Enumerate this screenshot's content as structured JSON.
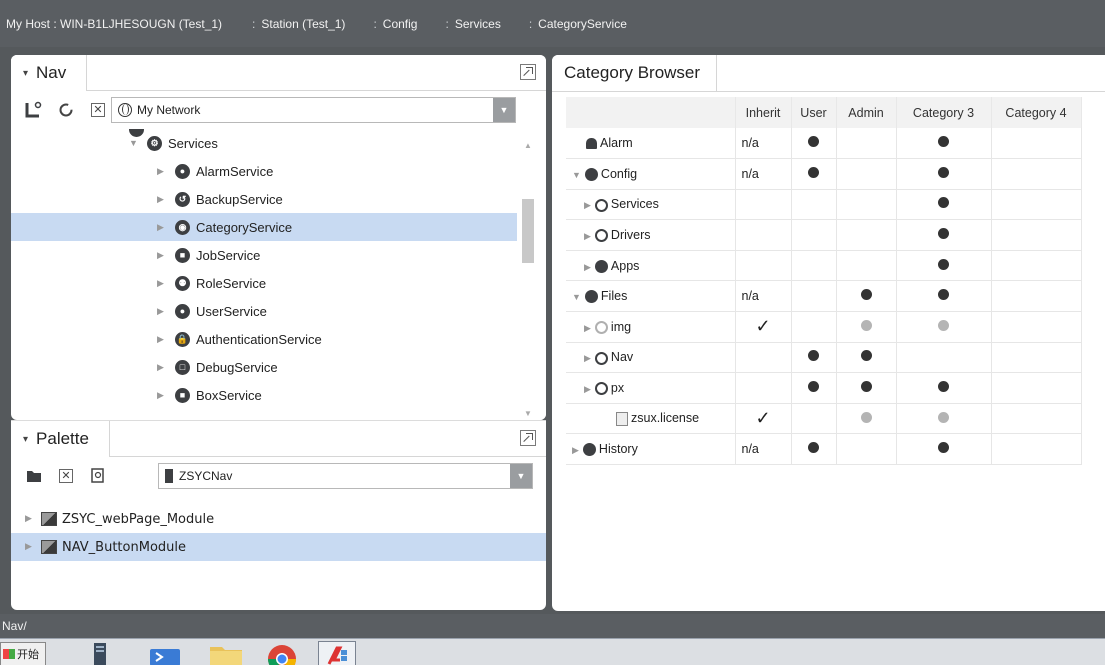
{
  "breadcrumbs": [
    {
      "label": "My Host : WIN-B1LJHESOUGN (Test_1)",
      "sep": ""
    },
    {
      "label": "Station (Test_1)",
      "sep": ":"
    },
    {
      "label": "Config",
      "sep": ":"
    },
    {
      "label": "Services",
      "sep": ":"
    },
    {
      "label": "CategoryService",
      "sep": ":"
    }
  ],
  "nav": {
    "tab_label": "Nav",
    "dropdown_value": "My Network",
    "tree": [
      {
        "label": "Services",
        "icon": "services-icon",
        "glyph": "⚙",
        "expanded": true,
        "indent": 1
      },
      {
        "label": "AlarmService",
        "icon": "alarm-icon",
        "glyph": "●",
        "indent": 2
      },
      {
        "label": "BackupService",
        "icon": "backup-icon",
        "glyph": "↺",
        "indent": 2
      },
      {
        "label": "CategoryService",
        "icon": "category-icon",
        "glyph": "◉",
        "indent": 2,
        "selected": true
      },
      {
        "label": "JobService",
        "icon": "job-icon",
        "glyph": "■",
        "indent": 2
      },
      {
        "label": "RoleService",
        "icon": "role-icon",
        "glyph": "⚉",
        "indent": 2
      },
      {
        "label": "UserService",
        "icon": "user-icon",
        "glyph": "●",
        "indent": 2
      },
      {
        "label": "AuthenticationService",
        "icon": "lock-icon",
        "glyph": "🔒",
        "indent": 2
      },
      {
        "label": "DebugService",
        "icon": "debug-icon",
        "glyph": "□",
        "indent": 2
      },
      {
        "label": "BoxService",
        "icon": "box-icon",
        "glyph": "■",
        "indent": 2
      }
    ]
  },
  "palette": {
    "tab_label": "Palette",
    "dropdown_value": "ZSYCNav",
    "items": [
      {
        "label": "ZSYC_webPage_Module",
        "selected": false
      },
      {
        "label": "NAV_ButtonModule",
        "selected": true
      }
    ]
  },
  "category_browser": {
    "tab_label": "Category Browser",
    "columns": [
      "",
      "Inherit",
      "User",
      "Admin",
      "Category 3",
      "Category 4"
    ],
    "rows": [
      {
        "name": "Alarm",
        "icon": "bell",
        "depth": 0,
        "tri": "",
        "inherit": "n/a",
        "cells": [
          "dark",
          "",
          "dark",
          ""
        ]
      },
      {
        "name": "Config",
        "icon": "solid",
        "depth": 0,
        "tri": "▼",
        "inherit": "n/a",
        "cells": [
          "dark",
          "",
          "dark",
          ""
        ]
      },
      {
        "name": "Services",
        "icon": "outline",
        "depth": 1,
        "tri": "▶",
        "inherit": "",
        "cells": [
          "",
          "",
          "dark",
          ""
        ]
      },
      {
        "name": "Drivers",
        "icon": "outline",
        "depth": 1,
        "tri": "▶",
        "inherit": "",
        "cells": [
          "",
          "",
          "dark",
          ""
        ]
      },
      {
        "name": "Apps",
        "icon": "solid",
        "depth": 1,
        "tri": "▶",
        "inherit": "",
        "cells": [
          "",
          "",
          "dark",
          ""
        ]
      },
      {
        "name": "Files",
        "icon": "solid",
        "depth": 0,
        "tri": "▼",
        "inherit": "n/a",
        "cells": [
          "",
          "dark",
          "dark",
          ""
        ]
      },
      {
        "name": "img",
        "icon": "outline-light",
        "depth": 1,
        "tri": "▶",
        "inherit": "check",
        "cells": [
          "",
          "light",
          "light",
          ""
        ]
      },
      {
        "name": "Nav",
        "icon": "outline",
        "depth": 1,
        "tri": "▶",
        "inherit": "",
        "cells": [
          "dark",
          "dark",
          "",
          ""
        ]
      },
      {
        "name": "px",
        "icon": "outline",
        "depth": 1,
        "tri": "▶",
        "inherit": "",
        "cells": [
          "dark",
          "dark",
          "dark",
          ""
        ]
      },
      {
        "name": "zsux.license",
        "icon": "file",
        "depth": 2,
        "tri": "",
        "inherit": "check",
        "cells": [
          "",
          "light",
          "light",
          ""
        ]
      },
      {
        "name": "History",
        "icon": "solid",
        "depth": 0,
        "tri": "▶",
        "inherit": "n/a",
        "cells": [
          "dark",
          "",
          "dark",
          ""
        ]
      }
    ]
  },
  "status": {
    "text": "Nav/"
  },
  "taskbar": {
    "start_label": "开始"
  }
}
